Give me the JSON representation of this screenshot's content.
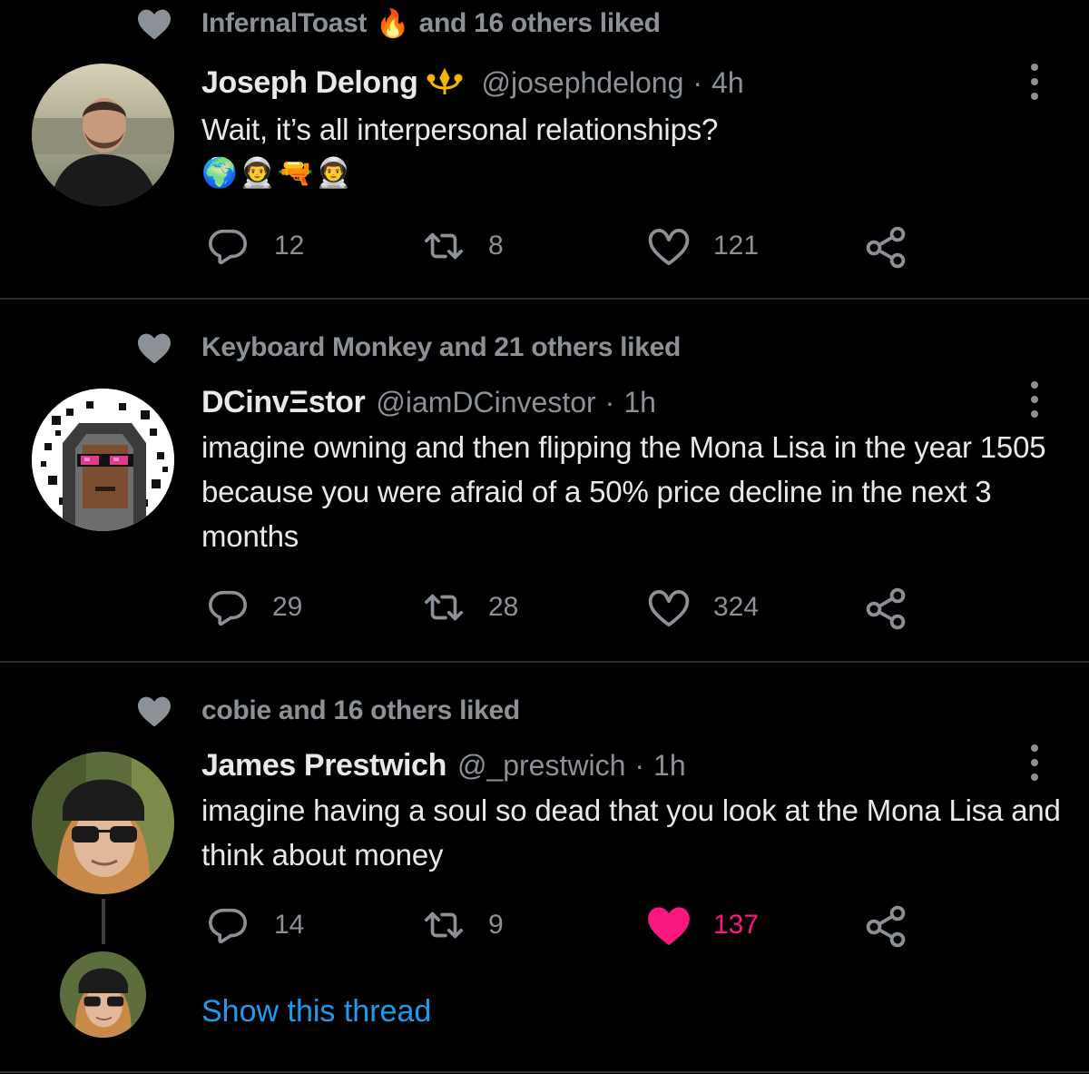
{
  "colors": {
    "background": "#000000",
    "muted": "#8b9197",
    "text": "#e7e9ea",
    "like_active": "#f91880",
    "link": "#1d9bf0",
    "divider": "#2b2f33"
  },
  "tweets": [
    {
      "social_context": "InfernalToast",
      "social_context_emoji": "🔥",
      "social_context_rest": "and 16 others liked",
      "name": "Joseph Delong",
      "name_badge": "badge-icon",
      "handle": "@josephdelong",
      "dot": "·",
      "time": "4h",
      "text": "Wait, it’s all interpersonal relationships?",
      "emoji_line": "🌍👨‍🚀🔫👨‍🚀",
      "replies": "12",
      "retweets": "8",
      "likes": "121",
      "liked": false
    },
    {
      "social_context": "Keyboard Monkey and 21 others liked",
      "name": "DCinvΞstor",
      "handle": "@iamDCinvestor",
      "dot": "·",
      "time": "1h",
      "text": "imagine owning and then flipping the Mona Lisa in the year 1505 because you were afraid of a 50% price decline in the next 3 months",
      "replies": "29",
      "retweets": "28",
      "likes": "324",
      "liked": false
    },
    {
      "social_context": "cobie and 16 others liked",
      "name": "James Prestwich",
      "handle": "@_prestwich",
      "dot": "·",
      "time": "1h",
      "text": "imagine having a soul so dead that you look at the Mona Lisa and think about money",
      "replies": "14",
      "retweets": "9",
      "likes": "137",
      "liked": true
    }
  ],
  "thread": {
    "show_label": "Show this thread"
  }
}
